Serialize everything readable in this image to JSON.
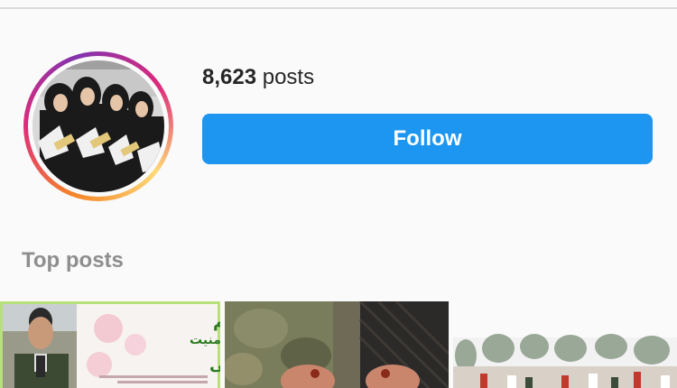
{
  "profile": {
    "post_count": "8,623",
    "post_unit": "posts"
  },
  "actions": {
    "follow_label": "Follow"
  },
  "section": {
    "title": "Top posts"
  },
  "top_posts": [
    {
      "lines": [
        "تحریم تحریم",
        "ناجا امنیت",
        "شهید محسن طحاسی"
      ]
    },
    {},
    {}
  ],
  "colors": {
    "follow_button": "#1c96f0",
    "section_title": "#8e8e8e",
    "text": "#262626",
    "story_ring": [
      "#f58529",
      "#dd2a7b",
      "#8134af",
      "#feda77"
    ]
  }
}
